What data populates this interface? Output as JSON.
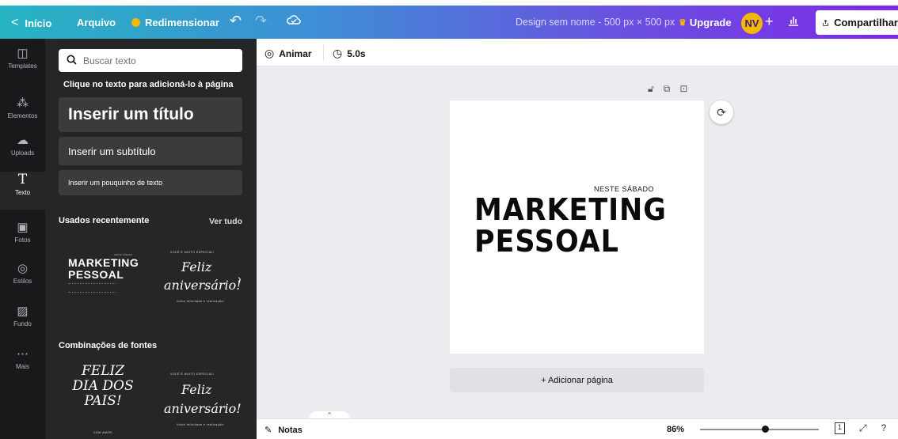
{
  "topbar": {
    "back_label": "Início",
    "file_label": "Arquivo",
    "resize_label": "Redimensionar",
    "design_name": "Design sem nome - 500 px × 500 px",
    "upgrade_label": "Upgrade",
    "avatar_initials": "NV",
    "share_label": "Compartilhar"
  },
  "rail": {
    "items": [
      {
        "label": "Templates",
        "icon": "templates-icon"
      },
      {
        "label": "Elementos",
        "icon": "elements-icon"
      },
      {
        "label": "Uploads",
        "icon": "uploads-icon"
      },
      {
        "label": "Texto",
        "icon": "text-icon"
      },
      {
        "label": "Fotos",
        "icon": "photos-icon"
      },
      {
        "label": "Estilos",
        "icon": "styles-icon"
      },
      {
        "label": "Fundo",
        "icon": "background-icon"
      },
      {
        "label": "Mais",
        "icon": "more-icon"
      }
    ],
    "active": "Texto"
  },
  "panel": {
    "search_placeholder": "Buscar texto",
    "hint": "Clique no texto para adicioná-lo à página",
    "add_title": "Inserir um título",
    "add_subtitle": "Inserir um subtítulo",
    "add_body": "Inserir um pouquinho de texto",
    "recent_heading": "Usados recentemente",
    "see_all": "Ver tudo",
    "combos_heading": "Combinações de fontes",
    "thumb_marketing": {
      "small": "NESTE SÁBADO",
      "line1": "MARKETING",
      "line2": "PESSOAL"
    },
    "thumb_feliz": {
      "top": "VOCÊ É MUITO ESPECIAL!",
      "line1": "Feliz",
      "line2": "aniversário!",
      "bottom": "Votos felicidade e realização!"
    },
    "thumb_pais": {
      "line1": "FELIZ",
      "line2": "DIA DOS",
      "line3": "PAIS!",
      "bottom": "COM AMOR,"
    }
  },
  "toolbar": {
    "animate_label": "Animar",
    "duration": "5.0s"
  },
  "canvas": {
    "kicker": "NESTE SÁBADO",
    "line1": "MARKETING",
    "line2": "PESSOAL"
  },
  "add_page_label": "+ Adicionar página",
  "bottom": {
    "notes_label": "Notas",
    "zoom": "86%",
    "page_number": "1"
  },
  "colors": {
    "gradient_start": "#27b4c2",
    "gradient_end": "#7d2ae8",
    "panel_bg": "#252627",
    "rail_bg": "#18191b",
    "accent_yellow": "#f5b800"
  }
}
